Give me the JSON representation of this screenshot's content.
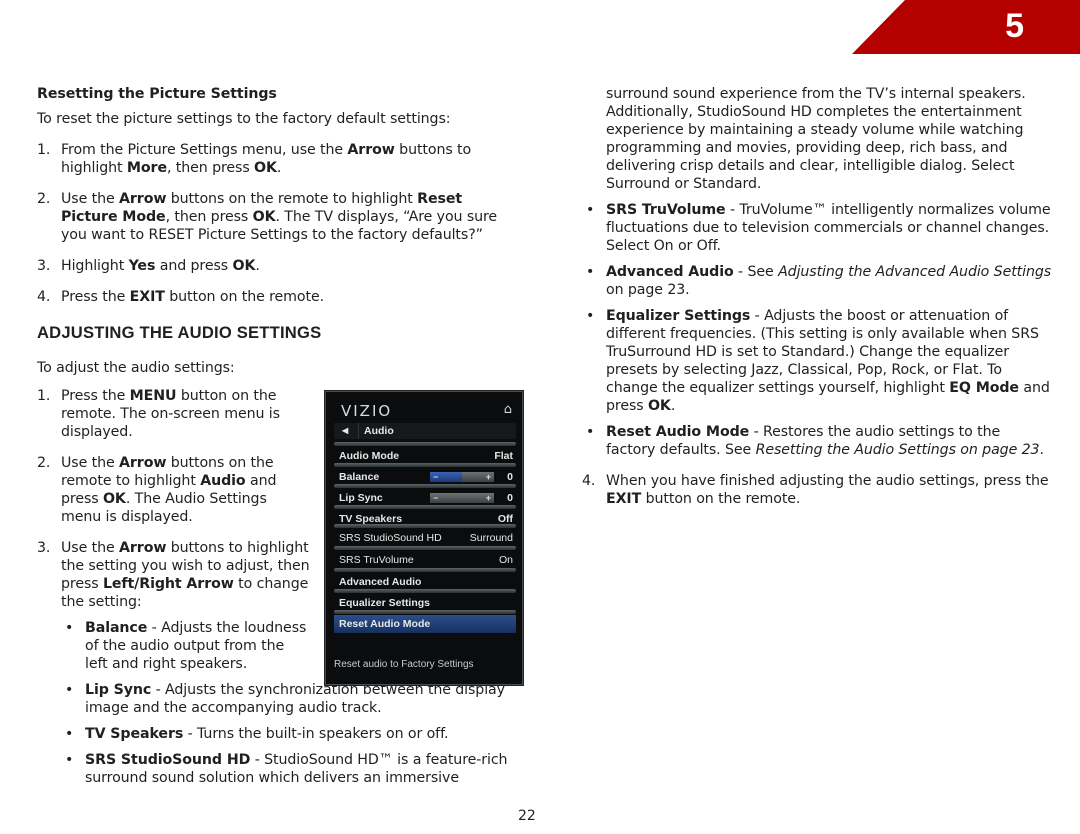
{
  "chapter": {
    "number": "5",
    "color": "#b50000"
  },
  "left": {
    "subhead": "Resetting the Picture Settings",
    "intro": "To reset the picture settings to the factory default settings:",
    "reset_steps": [
      {
        "num": "1.",
        "parts": [
          "From the Picture Settings menu, use the ",
          "Arrow",
          " buttons to highlight ",
          "More",
          ", then press ",
          "OK",
          "."
        ]
      },
      {
        "num": "2.",
        "parts": [
          "Use the ",
          "Arrow",
          " buttons on the remote to highlight ",
          "Reset Picture Mode",
          ", then press ",
          "OK",
          ". The TV displays, “Are you sure you want to RESET Picture Settings to the factory defaults?”"
        ]
      },
      {
        "num": "3.",
        "parts": [
          "Highlight ",
          "Yes",
          " and press ",
          "OK",
          "."
        ]
      },
      {
        "num": "4.",
        "parts": [
          "Press the ",
          "EXIT",
          " button on the remote."
        ]
      }
    ],
    "section_title": "ADJUSTING THE AUDIO SETTINGS",
    "audio_intro": "To adjust the audio settings:",
    "audio_steps": [
      {
        "num": "1.",
        "parts": [
          "Press the ",
          "MENU",
          " button on the remote. The on-screen menu is displayed."
        ]
      },
      {
        "num": "2.",
        "parts": [
          "Use the ",
          "Arrow",
          " buttons on the remote to highlight ",
          "Audio",
          " and press ",
          "OK",
          ". The Audio Settings menu is displayed."
        ]
      },
      {
        "num": "3.",
        "parts": [
          "Use the ",
          "Arrow",
          " buttons to highlight the setting you wish to adjust, then press ",
          "Left/Right Arrow",
          " to change the setting:"
        ]
      }
    ],
    "bullets": [
      {
        "term": "Balance",
        "text": " - Adjusts the loudness of the audio output from the left and right speakers."
      },
      {
        "term": "Lip Sync",
        "text": " - Adjusts the synchronization between the display image and the accompanying audio track."
      },
      {
        "term": "TV Speakers",
        "text": " - Turns the built-in speakers on or off."
      },
      {
        "term": "SRS StudioSound HD",
        "text": " - StudioSound HD™ is a feature-rich surround sound solution which delivers an immersive"
      }
    ]
  },
  "right": {
    "continuation": "surround sound experience from the TV’s internal speakers. Additionally, StudioSound HD completes the entertainment experience by maintaining a steady volume while watching programming and movies, providing deep, rich bass, and delivering crisp details and clear, intelligible dialog. Select Surround or Standard.",
    "bullets": [
      {
        "term": "SRS TruVolume",
        "text": " - TruVolume™ intelligently normalizes volume fluctuations due to television commercials or channel changes. Select On or Off."
      },
      {
        "term": "Advanced Audio",
        "pre": " - See ",
        "italic": "Adjusting the Advanced Audio Settings",
        "text": " on page 23."
      },
      {
        "term": "Equalizer Settings",
        "text": " - Adjusts the boost or attenuation of different frequencies. (This setting is only available when SRS TruSurround HD is set to Standard.) Change the equalizer presets by selecting Jazz, Classical, Pop, Rock, or Flat. To change the equalizer settings yourself, highlight ",
        "term2": "EQ Mode",
        "text2": " and press ",
        "term3": "OK",
        "text3": "."
      },
      {
        "term": "Reset Audio Mode",
        "pre": " - Restores the audio settings to the factory defaults. See ",
        "italic": "Resetting the Audio Settings on page 23",
        "text": "."
      }
    ],
    "final_step": {
      "num": "4.",
      "pre": "When you have finished adjusting the audio settings, press the ",
      "term": "EXIT",
      "text": " button on the remote."
    }
  },
  "tv_menu": {
    "logo": "VIZIO",
    "home_icon": "home-icon",
    "back_label": "Audio",
    "rows": [
      {
        "label": "Audio Mode",
        "value": "Flat"
      },
      {
        "label": "Balance",
        "value": "0",
        "slider_fill": 0.5
      },
      {
        "label": "Lip Sync",
        "value": "0",
        "slider_fill": 0
      },
      {
        "label": "TV Speakers",
        "value": "Off"
      },
      {
        "label": "SRS StudioSound HD",
        "value": "Surround"
      },
      {
        "label": "SRS TruVolume",
        "value": "On"
      },
      {
        "label": "Advanced Audio",
        "value": ""
      },
      {
        "label": "Equalizer Settings",
        "value": ""
      },
      {
        "label": "Reset Audio Mode",
        "value": "",
        "selected": true
      }
    ],
    "help_text": "Reset audio to Factory Settings"
  },
  "page_number": "22"
}
